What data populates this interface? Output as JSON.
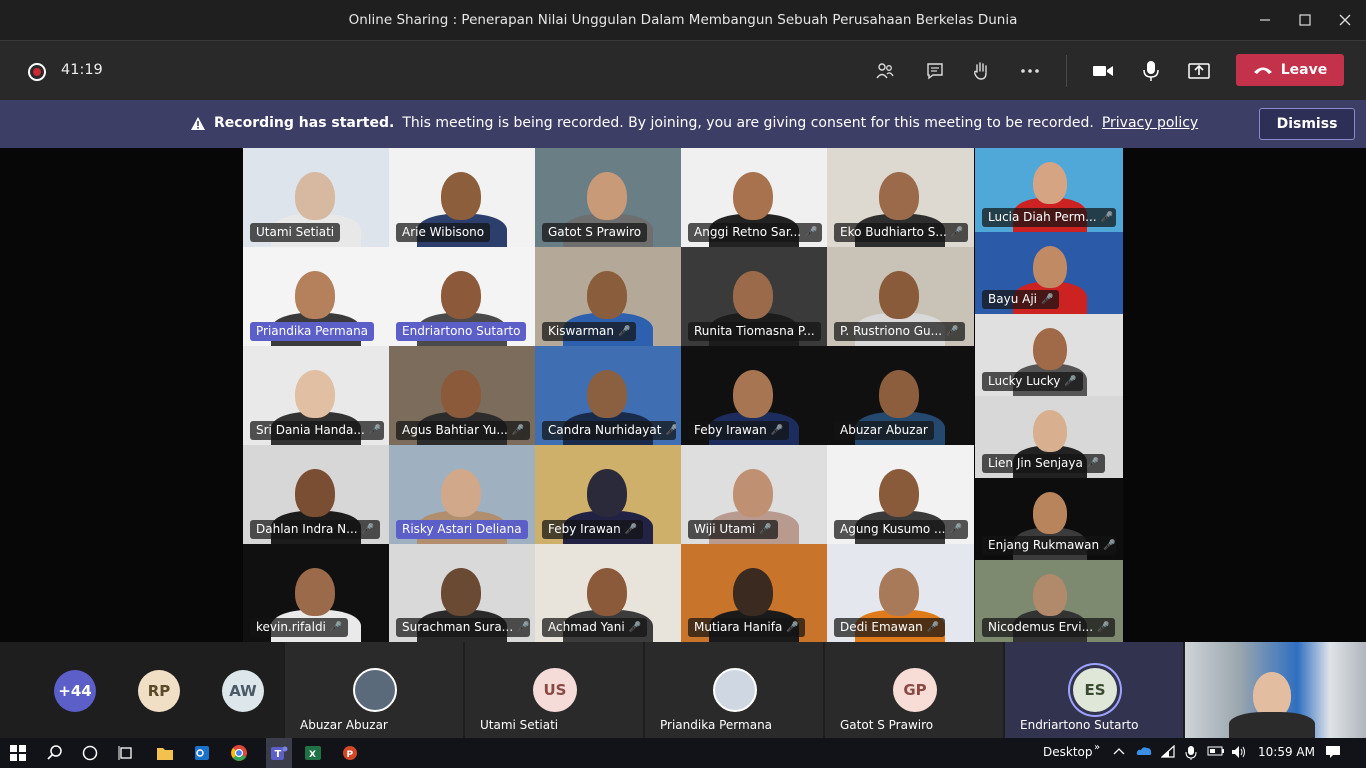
{
  "window": {
    "title": "Online Sharing : Penerapan Nilai Unggulan Dalam Membangun Sebuah Perusahaan Berkelas Dunia"
  },
  "toolbar": {
    "timer": "41:19",
    "leave_label": "Leave"
  },
  "banner": {
    "bold": "Recording has started.",
    "text": "This meeting is being recorded. By joining, you are giving consent for this meeting to be recorded.",
    "link": "Privacy policy",
    "dismiss_label": "Dismiss"
  },
  "grid": [
    {
      "name": "Utami Setiati",
      "muted": false,
      "highlight": false,
      "bg": "#dde4ec",
      "skin": "#d6b9a0",
      "shirt": "#e8e8e8"
    },
    {
      "name": "Arie Wibisono",
      "muted": false,
      "highlight": false,
      "bg": "#f2f2f2",
      "skin": "#8c5e3c",
      "shirt": "#2c3e6c"
    },
    {
      "name": "Gatot S Prawiro",
      "muted": false,
      "highlight": false,
      "bg": "#6a7e86",
      "skin": "#c89a78",
      "shirt": "#6e6e6e"
    },
    {
      "name": "Anggi Retno Sar...",
      "muted": true,
      "highlight": false,
      "bg": "#f0f0f0",
      "skin": "#a8724f",
      "shirt": "#222222"
    },
    {
      "name": "Eko Budhiarto S...",
      "muted": true,
      "highlight": false,
      "bg": "#ddd8d0",
      "skin": "#9a6a4a",
      "shirt": "#2e2e2e"
    },
    {
      "name": "Priandika Permana",
      "muted": false,
      "highlight": true,
      "bg": "#f4f4f4",
      "skin": "#b5805c",
      "shirt": "#3a3a3a"
    },
    {
      "name": "Endriartono Sutarto",
      "muted": false,
      "highlight": true,
      "bg": "#f4f4f4",
      "skin": "#8c5a3a",
      "shirt": "#4a4a4a"
    },
    {
      "name": "Kiswarman",
      "muted": true,
      "highlight": false,
      "bg": "#b4a999",
      "skin": "#8a5d3c",
      "shirt": "#2e60b0"
    },
    {
      "name": "Runita Tiomasna P...",
      "muted": false,
      "highlight": false,
      "bg": "#3a3a3a",
      "skin": "#9a6a4a",
      "shirt": "#1c1c1c"
    },
    {
      "name": "P. Rustriono Gu...",
      "muted": true,
      "highlight": false,
      "bg": "#c9c2b6",
      "skin": "#8a5b3b",
      "shirt": "#d9d9d9"
    },
    {
      "name": "Sri Dania Handa...",
      "muted": true,
      "highlight": false,
      "bg": "#e9e9e9",
      "skin": "#e0bfa2",
      "shirt": "#333333"
    },
    {
      "name": "Agus Bahtiar Yu...",
      "muted": true,
      "highlight": false,
      "bg": "#7c6c5c",
      "skin": "#8a5a3a",
      "shirt": "#2c2c2c"
    },
    {
      "name": "Candra Nurhidayat",
      "muted": true,
      "highlight": false,
      "bg": "#3f6fb2",
      "skin": "#8a6040",
      "shirt": "#1a2a4a"
    },
    {
      "name": "Feby Irawan",
      "muted": true,
      "highlight": false,
      "bg": "#101010",
      "skin": "#a87552",
      "shirt": "#1c2c5c"
    },
    {
      "name": "Abuzar Abuzar",
      "muted": false,
      "highlight": false,
      "bg": "#101010",
      "skin": "#8c5e3e",
      "shirt": "#25486e"
    },
    {
      "name": "Dahlan Indra N...",
      "muted": true,
      "highlight": false,
      "bg": "#d7d7d7",
      "skin": "#7a4e32",
      "shirt": "#1c1c1c"
    },
    {
      "name": "Risky Astari Deliana",
      "muted": false,
      "highlight": true,
      "bg": "#9fb0c0",
      "skin": "#d1a98a",
      "shirt": "#b08e6e"
    },
    {
      "name": "Feby Irawan",
      "muted": true,
      "highlight": false,
      "bg": "#cfb06a",
      "skin": "#2a2a3a",
      "shirt": "#222244"
    },
    {
      "name": "Wiji Utami",
      "muted": true,
      "highlight": false,
      "bg": "#dedede",
      "skin": "#c09072",
      "shirt": "#b89a8e"
    },
    {
      "name": "Agung Kusumo ...",
      "muted": true,
      "highlight": false,
      "bg": "#f2f2f2",
      "skin": "#8a5b3b",
      "shirt": "#3a3a3a"
    },
    {
      "name": "kevin.rifaldi",
      "muted": true,
      "highlight": false,
      "bg": "#101010",
      "skin": "#9a6a4a",
      "shirt": "#eaeaea"
    },
    {
      "name": "Surachman Sura...",
      "muted": true,
      "highlight": false,
      "bg": "#d9d9d9",
      "skin": "#6a4a32",
      "shirt": "#2a2a2a"
    },
    {
      "name": "Achmad Yani",
      "muted": true,
      "highlight": false,
      "bg": "#e8e4dc",
      "skin": "#8a5a3a",
      "shirt": "#3c3c3c"
    },
    {
      "name": "Mutiara Hanifa",
      "muted": true,
      "highlight": false,
      "bg": "#c8742a",
      "skin": "#3a2a20",
      "shirt": "#1a1a1a"
    },
    {
      "name": "Dedi Emawan",
      "muted": true,
      "highlight": false,
      "bg": "#e4e8ee",
      "skin": "#a87a5a",
      "shirt": "#e07b1c"
    }
  ],
  "right": [
    {
      "name": "Lucia Diah Perm...",
      "muted": true,
      "bg": "#4fa8d8",
      "skin": "#d4a483",
      "shirt": "#cc2222"
    },
    {
      "name": "Bayu Aji",
      "muted": true,
      "bg": "#2b5aa8",
      "skin": "#c08a64",
      "shirt": "#cc2222"
    },
    {
      "name": "Lucky Lucky",
      "muted": true,
      "bg": "#e0e0e0",
      "skin": "#a06a48",
      "shirt": "#555555"
    },
    {
      "name": "Lien Jin Senjaya",
      "muted": true,
      "bg": "#d8d8d8",
      "skin": "#d8b090",
      "shirt": "#222222"
    },
    {
      "name": "Enjang Rukmawan",
      "muted": true,
      "bg": "#0d0d0d",
      "skin": "#b8845c",
      "shirt": "#3b3b3b"
    },
    {
      "name": "Nicodemus Ervi...",
      "muted": true,
      "bg": "#7e8a70",
      "skin": "#b08a6a",
      "shirt": "#333333"
    }
  ],
  "strip": {
    "more": "+44",
    "initials": [
      {
        "text": "RP",
        "bg": "#f0dfc4",
        "fg": "#5a4a2a"
      },
      {
        "text": "AW",
        "bg": "#dde6ea",
        "fg": "#4a5a66"
      }
    ],
    "people": [
      {
        "name": "Abuzar Abuzar",
        "type": "photo",
        "bg": "#5a6a7a"
      },
      {
        "name": "Utami Setiati",
        "type": "initials",
        "initials": "US",
        "bg": "#f5dcd8",
        "fg": "#8a4a44"
      },
      {
        "name": "Priandika Permana",
        "type": "photo",
        "bg": "#cfd8e2"
      },
      {
        "name": "Gatot S Prawiro",
        "type": "initials",
        "initials": "GP",
        "bg": "#f7ddd6",
        "fg": "#8a4a44"
      },
      {
        "name": "Endriartono Sutarto",
        "type": "initials",
        "initials": "ES",
        "bg": "#dfe7d9",
        "fg": "#3a4a32",
        "speaking": true
      }
    ]
  },
  "taskbar": {
    "desktop": "Desktop",
    "time": "10:59 AM"
  },
  "colors": {
    "accent": "#5b5fc7",
    "leave": "#c4314b",
    "banner": "#3d3e66"
  }
}
